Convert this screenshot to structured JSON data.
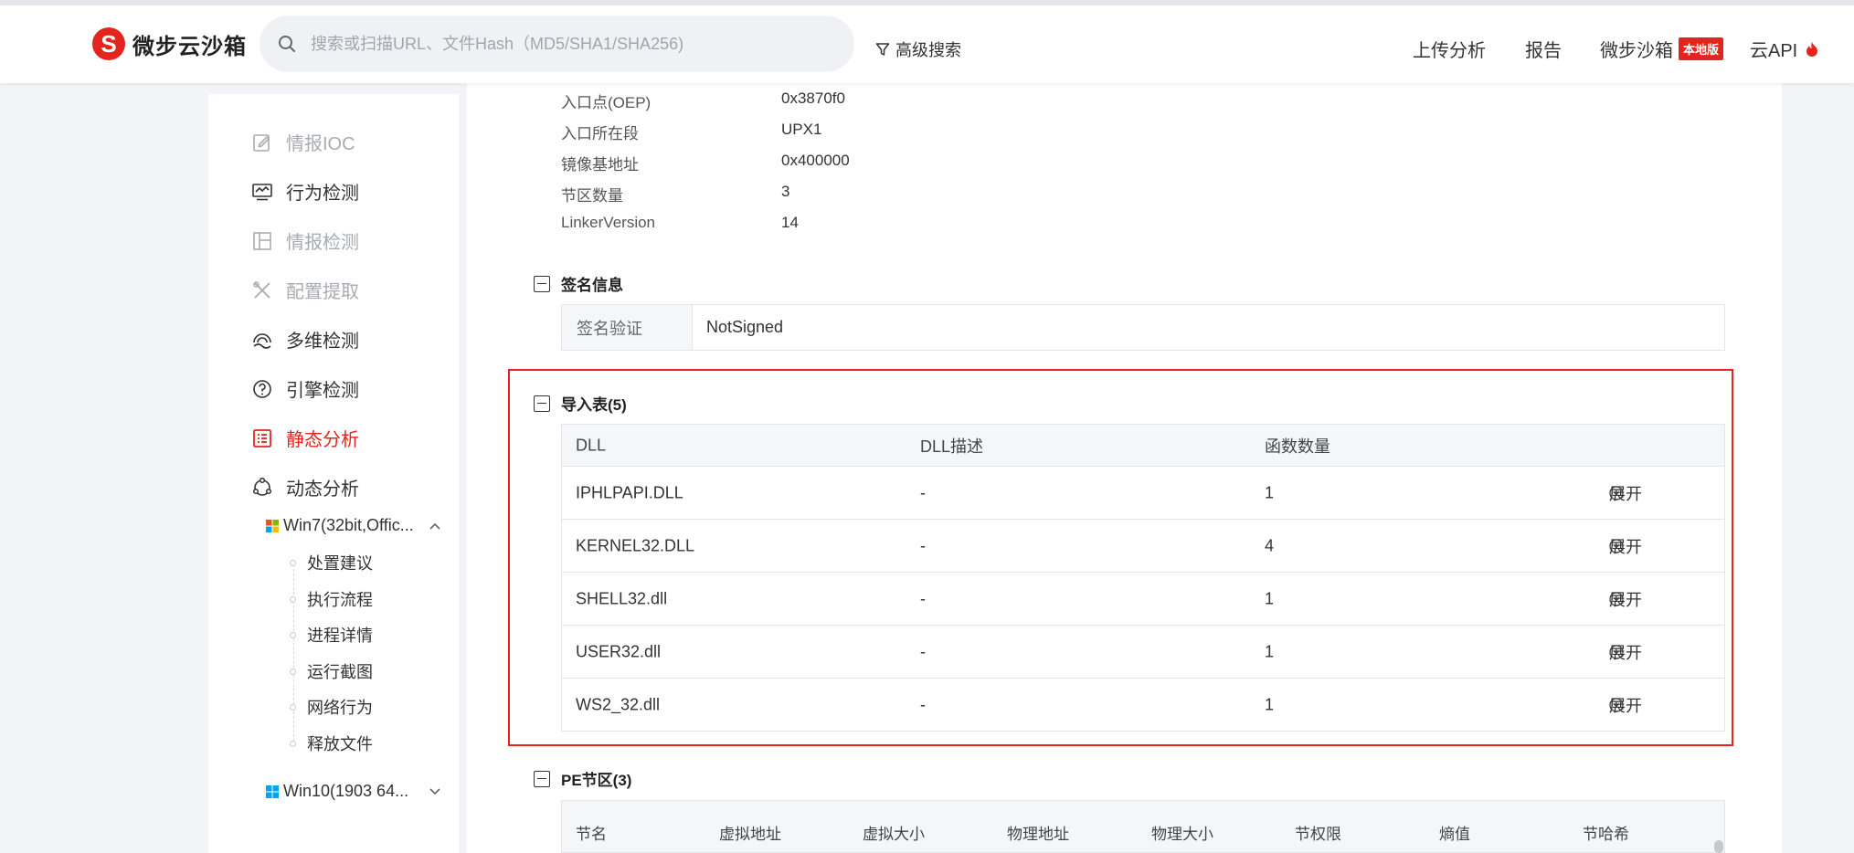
{
  "header": {
    "brand": "微步云沙箱",
    "search_placeholder": "搜索或扫描URL、文件Hash（MD5/SHA1/SHA256)",
    "advanced_search": "高级搜索",
    "nav": {
      "upload": "上传分析",
      "report": "报告",
      "sandbox": "微步沙箱",
      "sandbox_badge": "本地版",
      "api": "云API"
    }
  },
  "sidebar": {
    "items": [
      {
        "label": "情报IOC",
        "icon": "edit-icon",
        "state": "muted"
      },
      {
        "label": "行为检测",
        "icon": "monitor-chart-icon",
        "state": "normal"
      },
      {
        "label": "情报检测",
        "icon": "layout-icon",
        "state": "muted"
      },
      {
        "label": "配置提取",
        "icon": "tools-icon",
        "state": "muted"
      },
      {
        "label": "多维检测",
        "icon": "radar-icon",
        "state": "normal"
      },
      {
        "label": "引擎检测",
        "icon": "gauge-icon",
        "state": "normal"
      },
      {
        "label": "静态分析",
        "icon": "list-icon",
        "state": "active"
      },
      {
        "label": "动态分析",
        "icon": "cycle-icon",
        "state": "normal"
      }
    ],
    "os_envs": [
      {
        "label": "Win7(32bit,Offic...",
        "expanded": true
      },
      {
        "label": "Win10(1903 64...",
        "expanded": false
      }
    ],
    "sub_items": [
      "处置建议",
      "执行流程",
      "进程详情",
      "运行截图",
      "网络行为",
      "释放文件"
    ]
  },
  "pe_info": [
    {
      "key": "入口点(OEP)",
      "value": "0x3870f0"
    },
    {
      "key": "入口所在段",
      "value": "UPX1"
    },
    {
      "key": "镜像基地址",
      "value": "0x400000"
    },
    {
      "key": "节区数量",
      "value": "3"
    },
    {
      "key": "LinkerVersion",
      "value": "14"
    }
  ],
  "signature": {
    "title": "签名信息",
    "key": "签名验证",
    "value": "NotSigned"
  },
  "imports": {
    "title": "导入表(5)",
    "columns": [
      "DLL",
      "DLL描述",
      "函数数量"
    ],
    "expand_label": "展开",
    "rows": [
      {
        "dll": "IPHLPAPI.DLL",
        "desc": "-",
        "count": "1"
      },
      {
        "dll": "KERNEL32.DLL",
        "desc": "-",
        "count": "4"
      },
      {
        "dll": "SHELL32.dll",
        "desc": "-",
        "count": "1"
      },
      {
        "dll": "USER32.dll",
        "desc": "-",
        "count": "1"
      },
      {
        "dll": "WS2_32.dll",
        "desc": "-",
        "count": "1"
      }
    ]
  },
  "pe_sections": {
    "title": "PE节区(3)",
    "columns": [
      "节名",
      "虚拟地址",
      "虚拟大小",
      "物理地址",
      "物理大小",
      "节权限",
      "熵值",
      "节哈希"
    ]
  },
  "colors": {
    "accent": "#e4251d",
    "muted": "#a8abb2",
    "table_header_bg": "#f5f6f8",
    "page_bg": "#f3f4f8"
  }
}
